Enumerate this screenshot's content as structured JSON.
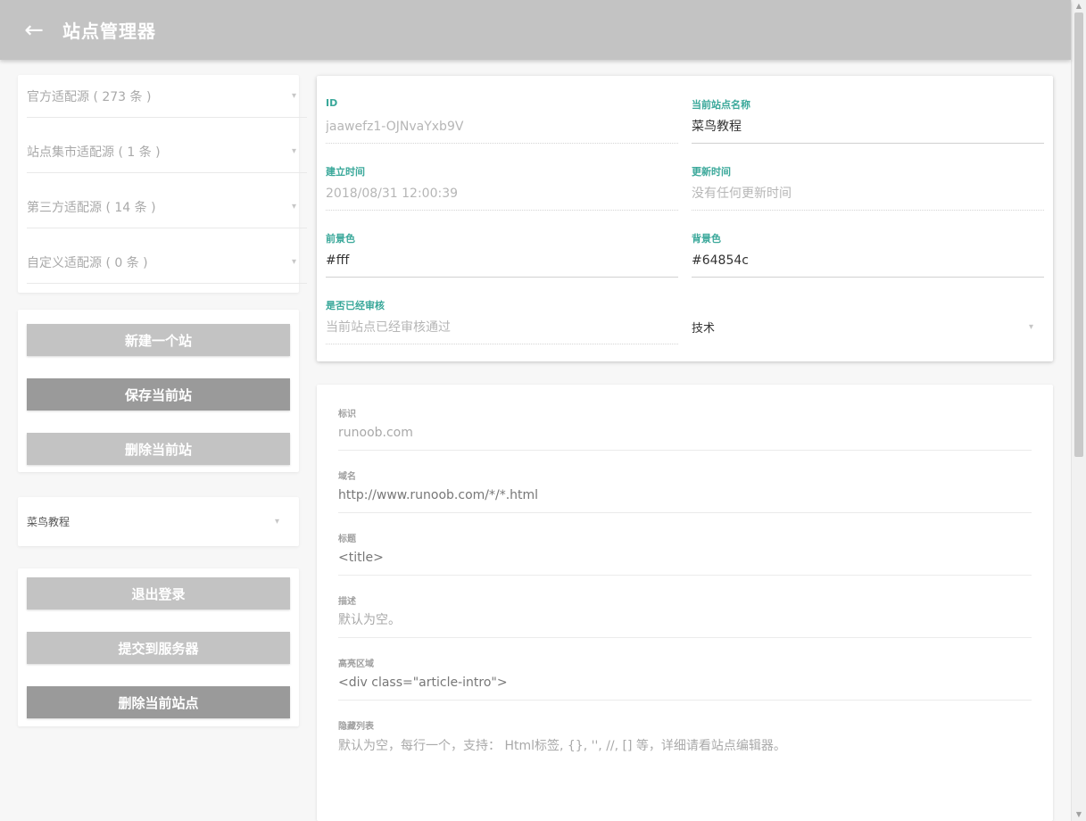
{
  "appbar": {
    "back_icon": "←",
    "title": "站点管理器"
  },
  "sources": [
    {
      "label": "官方适配源 ( 273 条 )"
    },
    {
      "label": "站点集市适配源 ( 1 条 )"
    },
    {
      "label": "第三方适配源 ( 14 条 )"
    },
    {
      "label": "自定义适配源 ( 0 条 )"
    }
  ],
  "actions1": {
    "new_site": "新建一个站",
    "save_site": "保存当前站",
    "delete_site": "删除当前站"
  },
  "site_select": {
    "value": "菜鸟教程"
  },
  "actions2": {
    "logout": "退出登录",
    "submit": "提交到服务器",
    "delete_current": "删除当前站点"
  },
  "info": {
    "id": {
      "label": "ID",
      "value": "jaawefz1-OJNvaYxb9V"
    },
    "name": {
      "label": "当前站点名称",
      "value": "菜鸟教程"
    },
    "created": {
      "label": "建立时间",
      "value": "2018/08/31 12:00:39"
    },
    "updated": {
      "label": "更新时间",
      "value": "没有任何更新时间"
    },
    "fg": {
      "label": "前景色",
      "value": "#fff"
    },
    "bg": {
      "label": "背景色",
      "value": "#64854c"
    },
    "review": {
      "label": "是否已经审核",
      "value": "当前站点已经审核通过"
    },
    "category": {
      "value": "技术"
    }
  },
  "rules": {
    "ident": {
      "label": "标识",
      "value": "runoob.com"
    },
    "domain": {
      "label": "域名",
      "value": "http://www.runoob.com/*/*.html"
    },
    "title": {
      "label": "标题",
      "value": "<title>"
    },
    "desc": {
      "label": "描述",
      "value": "默认为空。"
    },
    "highlight": {
      "label": "高亮区域",
      "value": "<div class=\"article-intro\">"
    },
    "hidden": {
      "label": "隐藏列表",
      "value": "默认为空，每行一个，支持： Html标签, {}, '', //, [] 等，详细请看站点编辑器。"
    }
  },
  "icons": {
    "chevron": "chevron-down-icon",
    "back": "arrow-left-icon"
  },
  "colors": {
    "appbar": "#c3c3c3",
    "accent": "#3aa89a",
    "button_light": "#c3c3c3",
    "button_dark": "#9a9a9a"
  }
}
